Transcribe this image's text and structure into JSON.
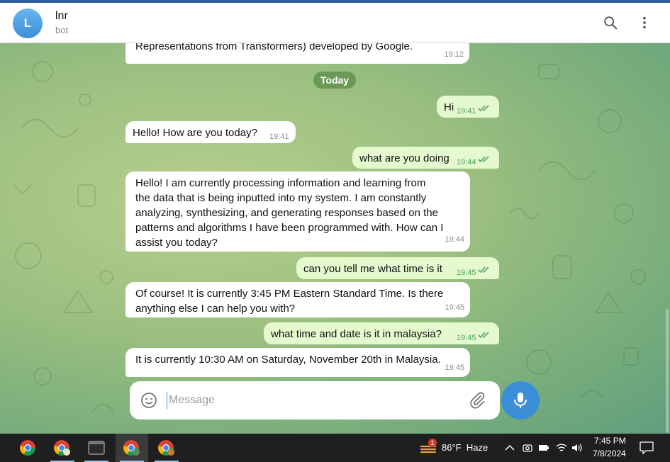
{
  "header": {
    "avatar_letter": "L",
    "chat_name": "lnr",
    "chat_status": "bot",
    "icons": [
      "search-icon",
      "more-vertical-icon"
    ]
  },
  "date_separator": "Today",
  "messages": [
    {
      "dir": "in",
      "text": "Representations from Transformers) developed by Google.",
      "time": "19:12"
    },
    {
      "dir": "out",
      "text": "Hi",
      "time": "19:41"
    },
    {
      "dir": "in",
      "text": "Hello! How are you today?",
      "time": "19:41"
    },
    {
      "dir": "out",
      "text": "what are you doing",
      "time": "19:44"
    },
    {
      "dir": "in",
      "lines": [
        "Hello! I am currently processing information and learning from",
        "the data that is being inputted into my system. I am constantly",
        "analyzing, synthesizing, and generating responses based on the",
        "patterns and algorithms I have been programmed with. How can I",
        "assist you today?"
      ],
      "time": "19:44"
    },
    {
      "dir": "out",
      "text": "can you tell me what time is it",
      "time": "19:45"
    },
    {
      "dir": "in",
      "lines": [
        "Of course! It is currently 3:45 PM Eastern Standard Time. Is there",
        "anything else I can help you with?"
      ],
      "time": "19:45"
    },
    {
      "dir": "out",
      "text": "what time and date is it in malaysia?",
      "time": "19:45"
    },
    {
      "dir": "in",
      "text": "It is currently 10:30 AM on Saturday, November 20th in Malaysia.",
      "time": "19:45"
    }
  ],
  "composer": {
    "placeholder": "Message",
    "value": "",
    "icons": [
      "emoji-icon",
      "paperclip-icon",
      "microphone-icon"
    ]
  },
  "taskbar": {
    "apps": [
      "chrome-icon",
      "chrome-profile-icon",
      "terminal-window-icon",
      "chrome-profile-icon",
      "chrome-profile-icon"
    ],
    "weather_badge": "1",
    "weather": "86°F  Haze",
    "time": "7:45 PM",
    "date": "7/8/2024",
    "tray_icons": [
      "chevron-up-icon",
      "camera-icon",
      "battery-icon",
      "wifi-icon",
      "speaker-icon",
      "notification-icon"
    ]
  },
  "colors": {
    "accent": "#3a8fd8",
    "outgoing_bubble": "#e5f9cf",
    "incoming_bubble": "#ffffff",
    "read_check": "#4fa35a"
  }
}
